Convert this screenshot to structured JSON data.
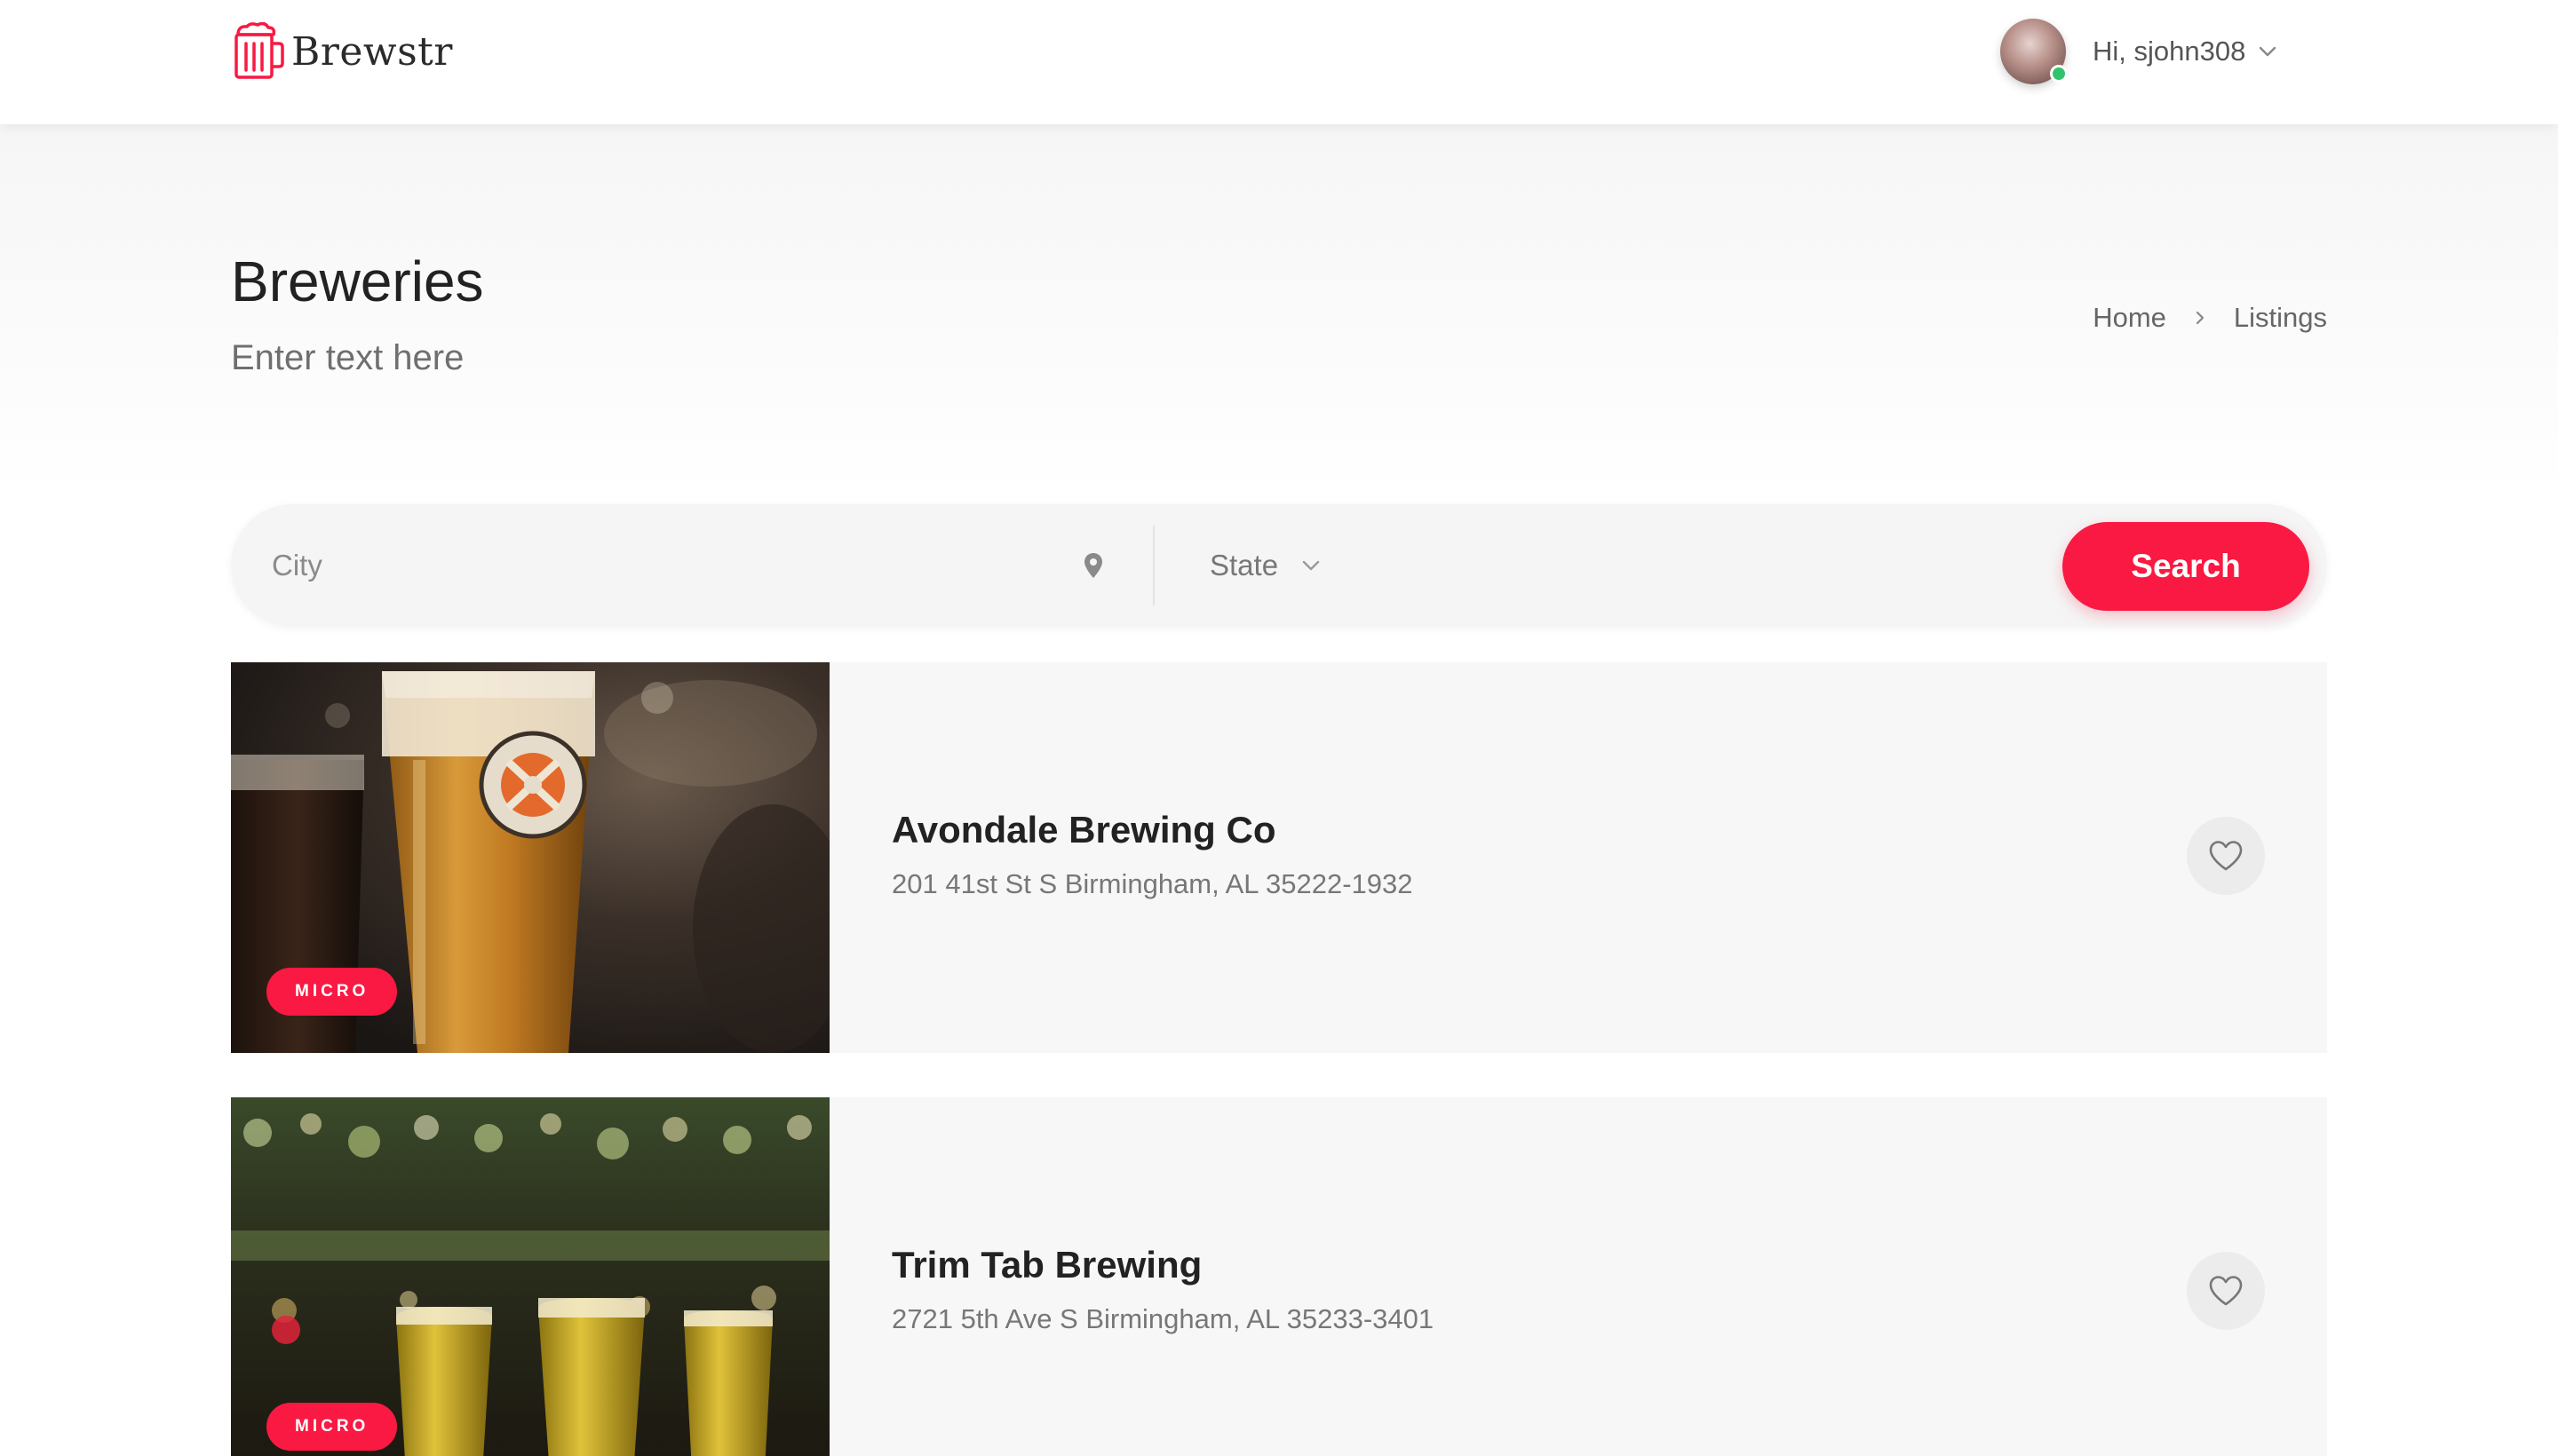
{
  "header": {
    "brand": "Brewstr",
    "user_greeting": "Hi, sjohn308"
  },
  "titlebar": {
    "title": "Breweries",
    "subtitle": "Enter text here",
    "breadcrumbs": [
      "Home",
      "Listings"
    ]
  },
  "search": {
    "city_placeholder": "City",
    "city_value": "",
    "state_label": "State",
    "button_label": "Search"
  },
  "listings": [
    {
      "name": "Avondale Brewing Co",
      "address": "201 41st St S Birmingham, AL 35222-1932",
      "type": "MICRO"
    },
    {
      "name": "Trim Tab Brewing",
      "address": "2721 5th Ave S Birmingham, AL 35233-3401",
      "type": "MICRO"
    }
  ],
  "icons": {
    "logo": "beer-mug-icon",
    "user_caret": "chevron-down-icon",
    "breadcrumb_separator": "chevron-right-icon",
    "city_field": "map-pin-icon",
    "state_caret": "chevron-down-icon",
    "favorite": "heart-outline-icon"
  },
  "colors": {
    "accent": "#f91942",
    "online_status": "#31c36b",
    "card_background": "#f7f7f7"
  }
}
